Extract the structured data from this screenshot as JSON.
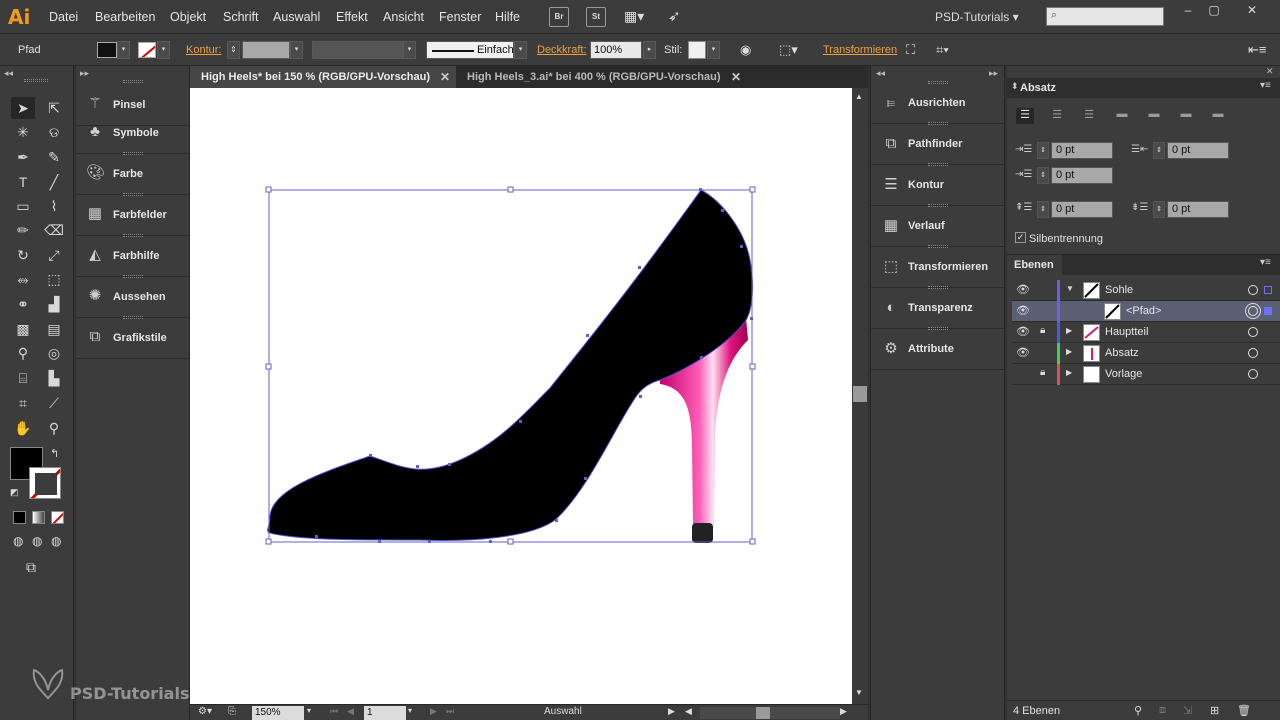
{
  "app": {
    "logo": "Ai",
    "workspace": "PSD-Tutorials",
    "workspace_arrow": "▾"
  },
  "menu": [
    "Datei",
    "Bearbeiten",
    "Objekt",
    "Schrift",
    "Auswahl",
    "Effekt",
    "Ansicht",
    "Fenster",
    "Hilfe"
  ],
  "menu_buttons": {
    "bridge": "Br",
    "stock": "St"
  },
  "window_controls": {
    "minimize": "–",
    "restore": "▢",
    "close": "✕"
  },
  "control_bar": {
    "selection_type": "Pfad",
    "stroke_label": "Kontur:",
    "stroke_style": "Einfach",
    "opacity_label": "Deckkraft:",
    "opacity_value": "100%",
    "style_label": "Stil:",
    "transform_label": "Transformieren"
  },
  "left_dock": [
    "Pinsel",
    "Symbole",
    "Farbe",
    "Farbfelder",
    "Farbhilfe",
    "Aussehen",
    "Grafikstile"
  ],
  "tabs": [
    {
      "title": "High Heels* bei 150 % (RGB/GPU-Vorschau)",
      "close": "✕"
    },
    {
      "title": "High Heels_3.ai* bei 400 % (RGB/GPU-Vorschau)",
      "close": "✕"
    }
  ],
  "right_dock": [
    "Ausrichten",
    "Pathfinder",
    "Kontur",
    "Verlauf",
    "Transformieren",
    "Transparenz",
    "Attribute"
  ],
  "paragraph_panel": {
    "title": "Absatz",
    "fields": [
      "0 pt",
      "0 pt",
      "0 pt",
      "0 pt",
      "0 pt"
    ],
    "hyphenation_label": "Silbentrennung",
    "hyphenation_checked": true
  },
  "layers_panel": {
    "title": "Ebenen",
    "layers": [
      {
        "name": "Sohle",
        "color": "#6f5fe0",
        "expanded": true
      },
      {
        "name": "<Pfad>",
        "color": "#6f5fe0",
        "selected": true
      },
      {
        "name": "Hauptteil",
        "color": "#3f5fe8",
        "locked": true
      },
      {
        "name": "Absatz",
        "color": "#3fd050"
      },
      {
        "name": "Vorlage",
        "color": "#e05050",
        "locked": true
      }
    ],
    "count": "4 Ebenen"
  },
  "status_bar": {
    "zoom": "150%",
    "artboard": "1",
    "tool": "Auswahl"
  },
  "watermark": "PSD-Tutorials.de"
}
